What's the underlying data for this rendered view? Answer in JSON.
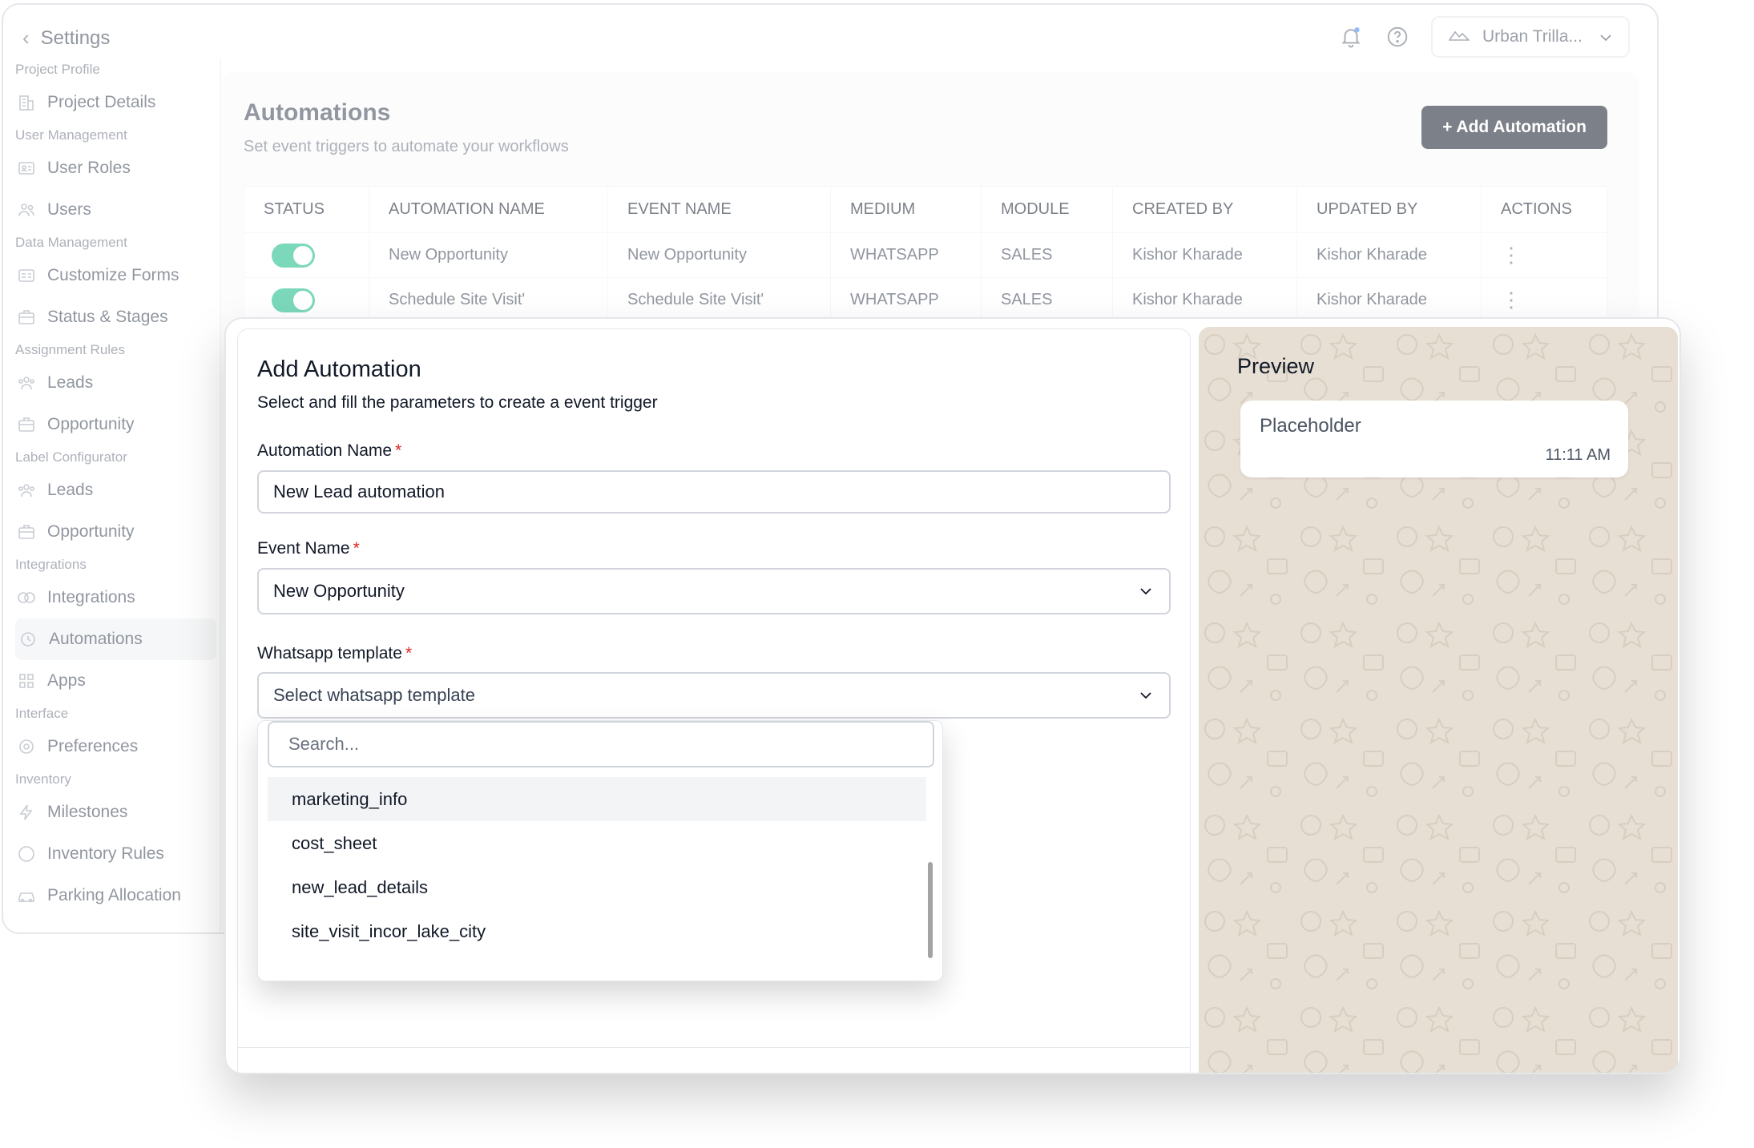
{
  "topbar": {
    "back_label": "Settings",
    "org_name": "Urban Trilla..."
  },
  "sidebar": {
    "groups": [
      {
        "section": "Project Profile",
        "items": [
          {
            "label": "Project Details",
            "icon": "building-icon"
          }
        ]
      },
      {
        "section": "User Management",
        "items": [
          {
            "label": "User Roles",
            "icon": "id-card-icon"
          },
          {
            "label": "Users",
            "icon": "users-icon"
          }
        ]
      },
      {
        "section": "Data Management",
        "items": [
          {
            "label": "Customize Forms",
            "icon": "form-icon"
          },
          {
            "label": "Status & Stages",
            "icon": "briefcase-icon"
          }
        ]
      },
      {
        "section": "Assignment Rules",
        "items": [
          {
            "label": "Leads",
            "icon": "users-group-icon"
          },
          {
            "label": "Opportunity",
            "icon": "briefcase-icon"
          }
        ]
      },
      {
        "section": "Label Configurator",
        "items": [
          {
            "label": "Leads",
            "icon": "users-group-icon"
          },
          {
            "label": "Opportunity",
            "icon": "briefcase-icon"
          }
        ]
      },
      {
        "section": "Integrations",
        "items": [
          {
            "label": "Integrations",
            "icon": "link-icon"
          },
          {
            "label": "Automations",
            "icon": "automation-icon"
          },
          {
            "label": "Apps",
            "icon": "apps-icon"
          }
        ]
      },
      {
        "section": "Interface",
        "items": [
          {
            "label": "Preferences",
            "icon": "gear-icon"
          }
        ]
      },
      {
        "section": "Inventory",
        "items": [
          {
            "label": "Milestones",
            "icon": "bolt-icon"
          },
          {
            "label": "Inventory Rules",
            "icon": "circle-icon"
          },
          {
            "label": "Parking Allocation",
            "icon": "car-icon"
          }
        ]
      }
    ],
    "active_label": "Automations"
  },
  "main": {
    "title": "Automations",
    "subtitle": "Set event triggers to automate your workflows",
    "add_button": "+ Add Automation",
    "columns": [
      "STATUS",
      "AUTOMATION NAME",
      "EVENT NAME",
      "MEDIUM",
      "MODULE",
      "CREATED BY",
      "UPDATED BY",
      "ACTIONS"
    ],
    "rows": [
      {
        "status": "on",
        "name": "New Opportunity",
        "event": "New Opportunity",
        "medium": "WHATSAPP",
        "module": "SALES",
        "created_by": "Kishor Kharade",
        "updated_by": "Kishor Kharade"
      },
      {
        "status": "on",
        "name": "Schedule Site Visit'",
        "event": "Schedule Site Visit'",
        "medium": "WHATSAPP",
        "module": "SALES",
        "created_by": "Kishor Kharade",
        "updated_by": "Kishor Kharade"
      }
    ]
  },
  "modal": {
    "title": "Add Automation",
    "subtitle": "Select and fill the parameters to create a event trigger",
    "automation_name_label": "Automation Name",
    "automation_name_value": "New Lead automation",
    "event_name_label": "Event Name",
    "event_name_value": "New Opportunity",
    "template_label": "Whatsapp template",
    "template_placeholder": "Select whatsapp template",
    "required_mark": "*",
    "dropdown": {
      "search_placeholder": "Search...",
      "options": [
        "marketing_info",
        "cost_sheet",
        "new_lead_details",
        "site_visit_incor_lake_city"
      ]
    },
    "preview": {
      "title": "Preview",
      "message": "Placeholder",
      "time": "11:11 AM"
    }
  },
  "colors": {
    "toggle_on": "#10b981",
    "primary_button": "#111827",
    "required": "#dc2626",
    "preview_bg": "#e7dfd3"
  }
}
